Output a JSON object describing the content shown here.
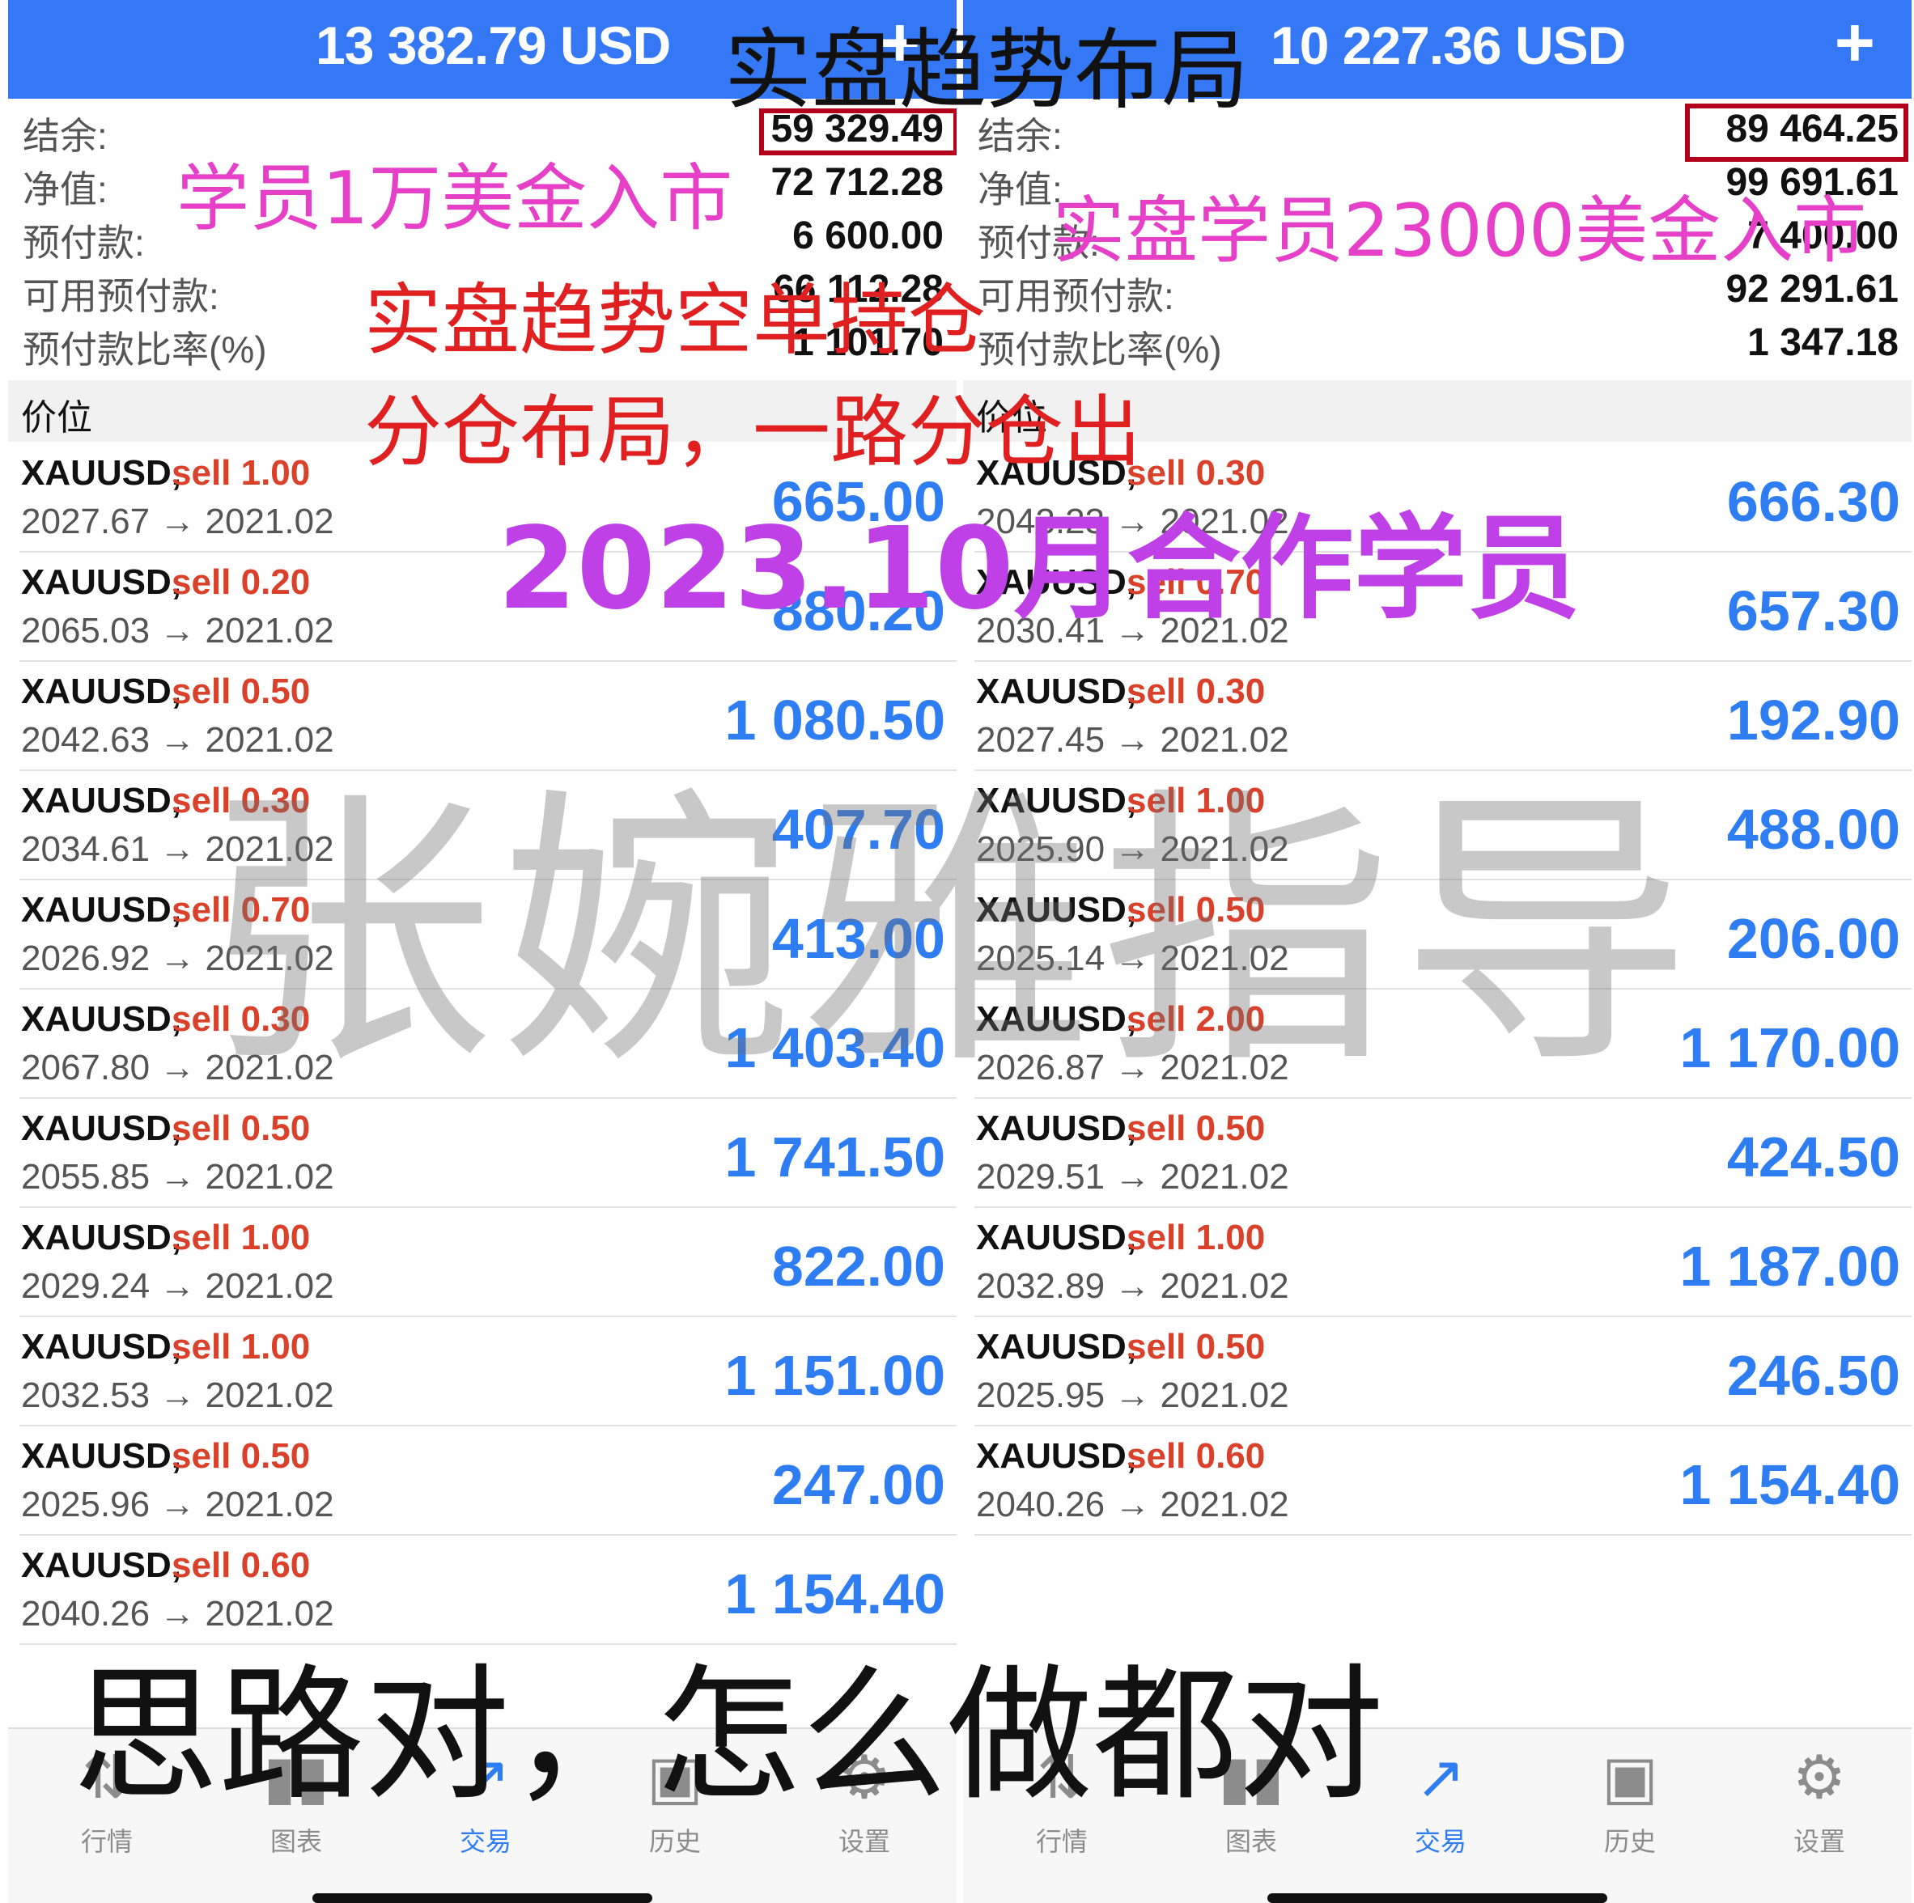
{
  "panels": [
    {
      "header_amount": "13 382.79 USD",
      "summary": [
        {
          "label": "结余:",
          "value": "59 329.49"
        },
        {
          "label": "净值:",
          "value": "72 712.28"
        },
        {
          "label": "预付款:",
          "value": "6 600.00"
        },
        {
          "label": "可用预付款:",
          "value": "66 112.28"
        },
        {
          "label": "预付款比率(%)",
          "value": "1 101.70"
        }
      ],
      "section_label": "价位",
      "positions": [
        {
          "symbol": "XAUUSD,",
          "side": "sell 1.00",
          "prices": "2027.67 → 2021.02",
          "profit": "665.00"
        },
        {
          "symbol": "XAUUSD,",
          "side": "sell 0.20",
          "prices": "2065.03 → 2021.02",
          "profit": "880.20"
        },
        {
          "symbol": "XAUUSD,",
          "side": "sell 0.50",
          "prices": "2042.63 → 2021.02",
          "profit": "1 080.50"
        },
        {
          "symbol": "XAUUSD,",
          "side": "sell 0.30",
          "prices": "2034.61 → 2021.02",
          "profit": "407.70"
        },
        {
          "symbol": "XAUUSD,",
          "side": "sell 0.70",
          "prices": "2026.92 → 2021.02",
          "profit": "413.00"
        },
        {
          "symbol": "XAUUSD,",
          "side": "sell 0.30",
          "prices": "2067.80 → 2021.02",
          "profit": "1 403.40"
        },
        {
          "symbol": "XAUUSD,",
          "side": "sell 0.50",
          "prices": "2055.85 → 2021.02",
          "profit": "1 741.50"
        },
        {
          "symbol": "XAUUSD,",
          "side": "sell 1.00",
          "prices": "2029.24 → 2021.02",
          "profit": "822.00"
        },
        {
          "symbol": "XAUUSD,",
          "side": "sell 1.00",
          "prices": "2032.53 → 2021.02",
          "profit": "1 151.00"
        },
        {
          "symbol": "XAUUSD,",
          "side": "sell 0.50",
          "prices": "2025.96 → 2021.02",
          "profit": "247.00"
        },
        {
          "symbol": "XAUUSD,",
          "side": "sell 0.60",
          "prices": "2040.26 → 2021.02",
          "profit": "1 154.40"
        }
      ],
      "tabs": [
        {
          "label": "行情",
          "icon": "quotes-icon"
        },
        {
          "label": "图表",
          "icon": "chart-icon"
        },
        {
          "label": "交易",
          "icon": "trade-icon"
        },
        {
          "label": "历史",
          "icon": "history-icon"
        },
        {
          "label": "设置",
          "icon": "settings-icon"
        }
      ]
    },
    {
      "header_amount": "10 227.36 USD",
      "summary": [
        {
          "label": "结余:",
          "value": "89 464.25"
        },
        {
          "label": "净值:",
          "value": "99 691.61"
        },
        {
          "label": "预付款:",
          "value": "7 400.00"
        },
        {
          "label": "可用预付款:",
          "value": "92 291.61"
        },
        {
          "label": "预付款比率(%)",
          "value": "1 347.18"
        }
      ],
      "section_label": "价位",
      "positions": [
        {
          "symbol": "XAUUSD,",
          "side": "sell 0.30",
          "prices": "2043.23 → 2021.02",
          "profit": "666.30"
        },
        {
          "symbol": "XAUUSD,",
          "side": "sell 0.70",
          "prices": "2030.41 → 2021.02",
          "profit": "657.30"
        },
        {
          "symbol": "XAUUSD,",
          "side": "sell 0.30",
          "prices": "2027.45 → 2021.02",
          "profit": "192.90"
        },
        {
          "symbol": "XAUUSD,",
          "side": "sell 1.00",
          "prices": "2025.90 → 2021.02",
          "profit": "488.00"
        },
        {
          "symbol": "XAUUSD,",
          "side": "sell 0.50",
          "prices": "2025.14 → 2021.02",
          "profit": "206.00"
        },
        {
          "symbol": "XAUUSD,",
          "side": "sell 2.00",
          "prices": "2026.87 → 2021.02",
          "profit": "1 170.00"
        },
        {
          "symbol": "XAUUSD,",
          "side": "sell 0.50",
          "prices": "2029.51 → 2021.02",
          "profit": "424.50"
        },
        {
          "symbol": "XAUUSD,",
          "side": "sell 1.00",
          "prices": "2032.89 → 2021.02",
          "profit": "1 187.00"
        },
        {
          "symbol": "XAUUSD,",
          "side": "sell 0.50",
          "prices": "2025.95 → 2021.02",
          "profit": "246.50"
        },
        {
          "symbol": "XAUUSD,",
          "side": "sell 0.60",
          "prices": "2040.26 → 2021.02",
          "profit": "1 154.40"
        }
      ],
      "tabs": [
        {
          "label": "行情",
          "icon": "quotes-icon"
        },
        {
          "label": "图表",
          "icon": "chart-icon"
        },
        {
          "label": "交易",
          "icon": "trade-icon"
        },
        {
          "label": "历史",
          "icon": "history-icon"
        },
        {
          "label": "设置",
          "icon": "settings-icon"
        }
      ]
    }
  ],
  "overlay": {
    "title": "实盘趋势布局",
    "pink_left": "学员1万美金入市",
    "pink_right": "实盘学员23000美金入市",
    "red_line1": "实盘趋势空单持仓",
    "red_line2": "分仓布局，一路分仓出",
    "purple": "2023.10月合作学员",
    "watermark": "张婉雅指导",
    "bottom": "思路对，怎么做都对"
  },
  "colors": {
    "header_blue": "#3478f6",
    "profit_blue": "#2f7df3",
    "sell_red": "#d9412b",
    "highlight_box": "#b3001b",
    "overlay_pink": "#e640c8",
    "overlay_red": "#e02020",
    "overlay_purple": "#c040e8"
  }
}
